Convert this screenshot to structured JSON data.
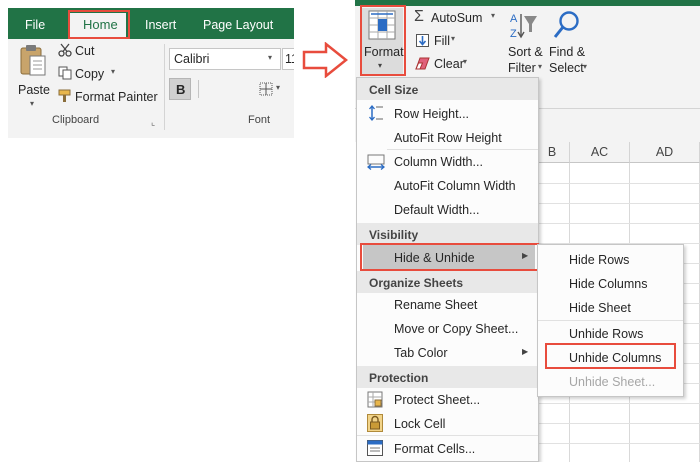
{
  "left_ribbon": {
    "tabs": {
      "file": "File",
      "home": "Home",
      "insert": "Insert",
      "page_layout": "Page Layout"
    },
    "clipboard": {
      "paste": "Paste",
      "cut": "Cut",
      "copy": "Copy",
      "format_painter": "Format Painter",
      "group_label": "Clipboard"
    },
    "font": {
      "name": "Calibri",
      "size": "11",
      "bold": "B",
      "group_label": "Font"
    }
  },
  "right_ribbon": {
    "format_label": "Format",
    "autosum": "AutoSum",
    "fill": "Fill",
    "clear": "Clear",
    "sort_filter": [
      "Sort &",
      "Filter"
    ],
    "find_select": [
      "Find &",
      "Select"
    ]
  },
  "sheet": {
    "columns": [
      "B",
      "AC",
      "AD"
    ]
  },
  "format_menu": {
    "sections": {
      "cell_size": "Cell Size",
      "visibility": "Visibility",
      "organize": "Organize Sheets",
      "protection": "Protection"
    },
    "items": {
      "row_height": "Row Height...",
      "autofit_row": "AutoFit Row Height",
      "column_width": "Column Width...",
      "autofit_column": "AutoFit Column Width",
      "default_width": "Default Width...",
      "hide_unhide": "Hide & Unhide",
      "rename_sheet": "Rename Sheet",
      "move_copy": "Move or Copy Sheet...",
      "tab_color": "Tab Color",
      "protect_sheet": "Protect Sheet...",
      "lock_cell": "Lock Cell",
      "format_cells": "Format Cells..."
    }
  },
  "submenu": {
    "hide_rows": "Hide Rows",
    "hide_columns": "Hide Columns",
    "hide_sheet": "Hide Sheet",
    "unhide_rows": "Unhide Rows",
    "unhide_columns": "Unhide Columns",
    "unhide_sheet": "Unhide Sheet..."
  },
  "colors": {
    "excel_green": "#217346",
    "highlight_red": "#e84c3d",
    "menu_hover": "#c6c6c6",
    "ribbon_bg": "#f3f3f3"
  }
}
